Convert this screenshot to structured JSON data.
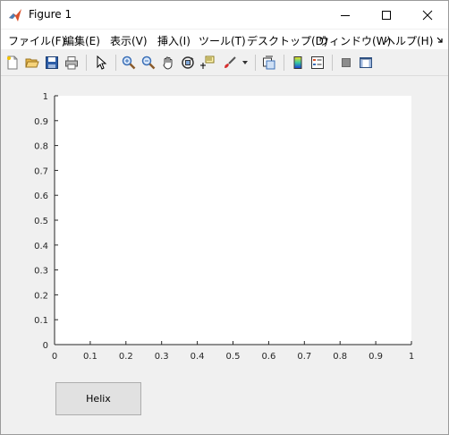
{
  "window": {
    "title": "Figure 1"
  },
  "menu": [
    "ファイル(F)",
    "編集(E)",
    "表示(V)",
    "挿入(I)",
    "ツール(T)",
    "デスクトップ(D)",
    "ウィンドウ(W)",
    "ヘルプ(H)"
  ],
  "toolbar": {
    "icons": [
      "new-figure-icon",
      "open-file-icon",
      "save-icon",
      "print-icon",
      "edit-plot-icon",
      "zoom-in-icon",
      "zoom-out-icon",
      "pan-icon",
      "rotate-3d-icon",
      "data-cursor-icon",
      "brush-icon",
      "link-plot-icon",
      "colorbar-icon",
      "legend-icon",
      "hide-plot-tools-icon",
      "show-plot-tools-icon"
    ]
  },
  "chart_data": {
    "type": "line",
    "title": "",
    "xlabel": "",
    "ylabel": "",
    "xlim": [
      0,
      1
    ],
    "ylim": [
      0,
      1
    ],
    "xticks": [
      "0",
      "0.1",
      "0.2",
      "0.3",
      "0.4",
      "0.5",
      "0.6",
      "0.7",
      "0.8",
      "0.9",
      "1"
    ],
    "yticks": [
      "0",
      "0.1",
      "0.2",
      "0.3",
      "0.4",
      "0.5",
      "0.6",
      "0.7",
      "0.8",
      "0.9",
      "1"
    ],
    "series": [],
    "grid": false
  },
  "controls": {
    "helix_button": "Helix"
  }
}
